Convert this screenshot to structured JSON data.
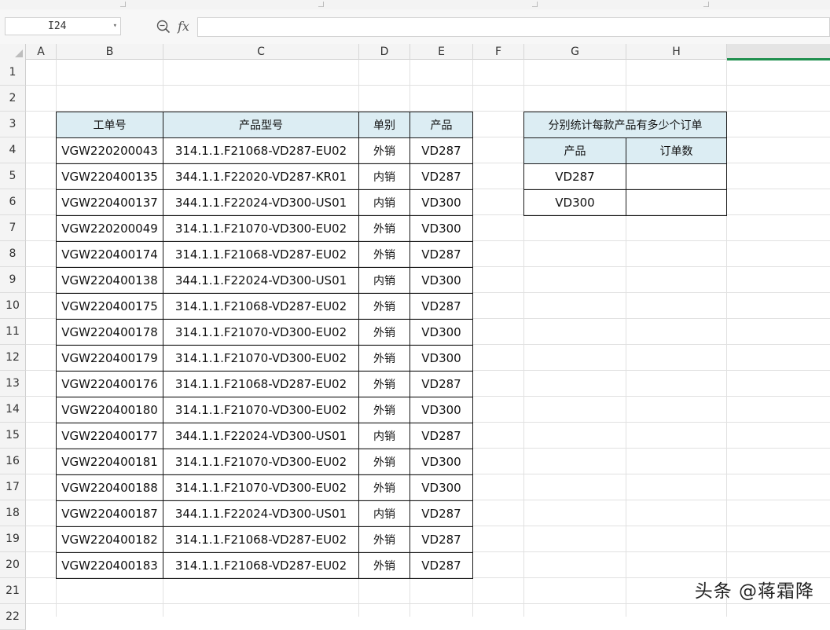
{
  "formula_bar": {
    "name_box": "I24",
    "zoom_icon": "zoom-icon",
    "fx_label": "fx",
    "formula_value": ""
  },
  "columns": [
    "A",
    "B",
    "C",
    "D",
    "E",
    "F",
    "G",
    "H"
  ],
  "selected_column": "I",
  "rows": [
    "1",
    "2",
    "3",
    "4",
    "5",
    "6",
    "7",
    "8",
    "9",
    "10",
    "11",
    "12",
    "13",
    "14",
    "15",
    "16",
    "17",
    "18",
    "19",
    "20",
    "21",
    "22"
  ],
  "main_table": {
    "headers": [
      "工单号",
      "产品型号",
      "单别",
      "产品"
    ],
    "rows": [
      [
        "VGW220200043",
        "314.1.1.F21068-VD287-EU02",
        "外销",
        "VD287"
      ],
      [
        "VGW220400135",
        "344.1.1.F22020-VD287-KR01",
        "内销",
        "VD287"
      ],
      [
        "VGW220400137",
        "344.1.1.F22024-VD300-US01",
        "内销",
        "VD300"
      ],
      [
        "VGW220200049",
        "314.1.1.F21070-VD300-EU02",
        "外销",
        "VD300"
      ],
      [
        "VGW220400174",
        "314.1.1.F21068-VD287-EU02",
        "外销",
        "VD287"
      ],
      [
        "VGW220400138",
        "344.1.1.F22024-VD300-US01",
        "内销",
        "VD300"
      ],
      [
        "VGW220400175",
        "314.1.1.F21068-VD287-EU02",
        "外销",
        "VD287"
      ],
      [
        "VGW220400178",
        "314.1.1.F21070-VD300-EU02",
        "外销",
        "VD300"
      ],
      [
        "VGW220400179",
        "314.1.1.F21070-VD300-EU02",
        "外销",
        "VD300"
      ],
      [
        "VGW220400176",
        "314.1.1.F21068-VD287-EU02",
        "外销",
        "VD287"
      ],
      [
        "VGW220400180",
        "314.1.1.F21070-VD300-EU02",
        "外销",
        "VD300"
      ],
      [
        "VGW220400177",
        "344.1.1.F22024-VD300-US01",
        "内销",
        "VD287"
      ],
      [
        "VGW220400181",
        "314.1.1.F21070-VD300-EU02",
        "外销",
        "VD300"
      ],
      [
        "VGW220400188",
        "314.1.1.F21070-VD300-EU02",
        "外销",
        "VD300"
      ],
      [
        "VGW220400187",
        "344.1.1.F22024-VD300-US01",
        "内销",
        "VD287"
      ],
      [
        "VGW220400182",
        "314.1.1.F21068-VD287-EU02",
        "外销",
        "VD287"
      ],
      [
        "VGW220400183",
        "314.1.1.F21068-VD287-EU02",
        "外销",
        "VD287"
      ]
    ]
  },
  "summary_table": {
    "title": "分别统计每款产品有多少个订单",
    "headers": [
      "产品",
      "订单数"
    ],
    "rows": [
      [
        "VD287",
        ""
      ],
      [
        "VD300",
        ""
      ]
    ]
  },
  "watermark": "头条 @蒋霜降",
  "colors": {
    "header_fill": "#dcedf3",
    "selected_column_accent": "#1f8f4e"
  }
}
